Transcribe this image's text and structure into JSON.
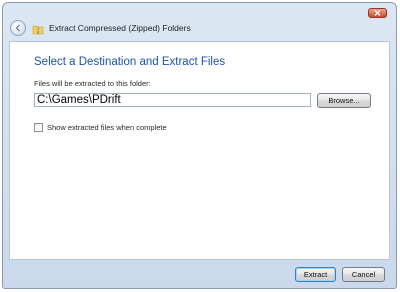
{
  "window": {
    "title": "Extract Compressed (Zipped) Folders"
  },
  "content": {
    "heading": "Select a Destination and Extract Files",
    "field_label": "Files will be extracted to this folder:",
    "path_value": "C:\\Games\\PDrift",
    "browse_label": "Browse...",
    "checkbox_label": "Show extracted files when complete",
    "checkbox_checked": false
  },
  "footer": {
    "extract_label": "Extract",
    "cancel_label": "Cancel"
  },
  "colors": {
    "heading": "#1d52a5",
    "frame": "#dce7f3",
    "close": "#cc4a30"
  },
  "icons": {
    "back": "back-arrow-icon",
    "title": "zip-folder-icon",
    "close": "close-icon"
  }
}
